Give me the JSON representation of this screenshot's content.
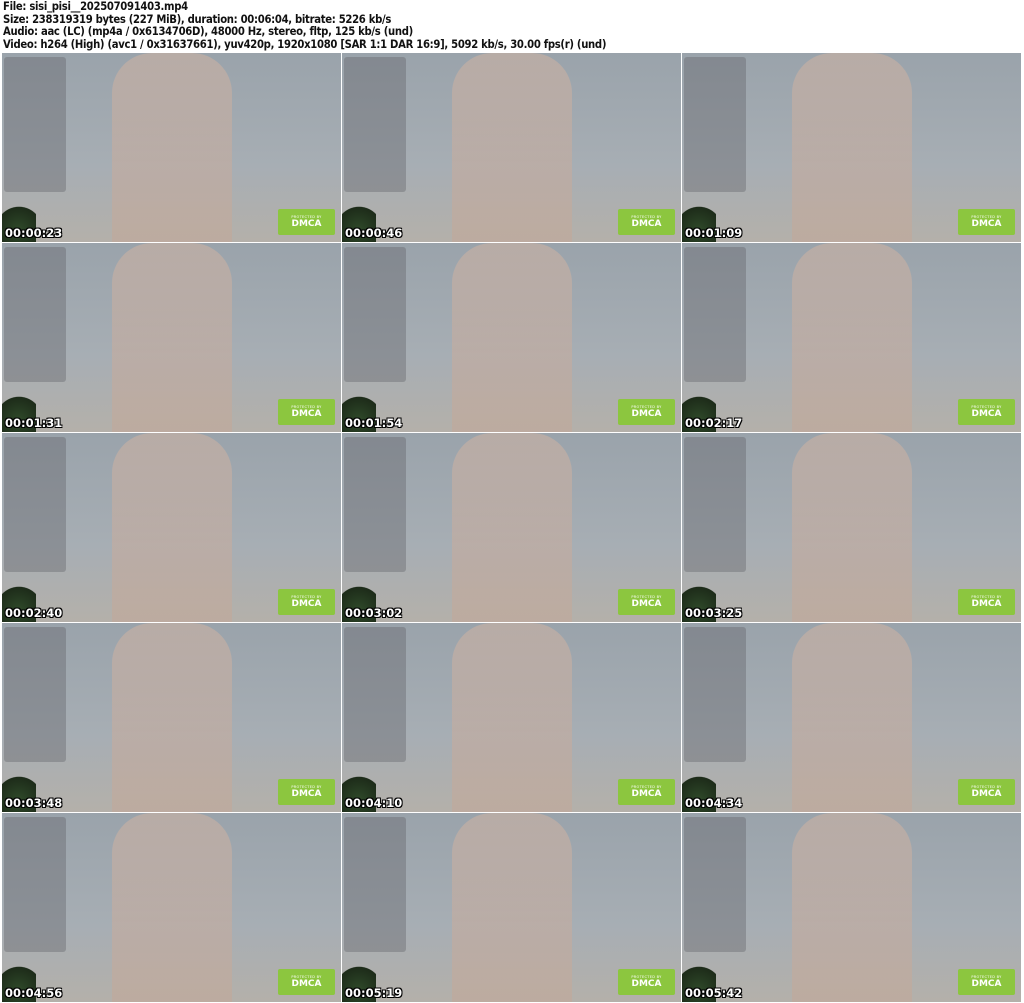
{
  "header": {
    "file": "File: sisi_pisi__202507091403.mp4",
    "size": "Size: 238319319 bytes (227 MiB), duration: 00:06:04, bitrate: 5226 kb/s",
    "audio": "Audio: aac (LC) (mp4a / 0x6134706D), 48000 Hz, stereo, fltp, 125 kb/s (und)",
    "video": "Video: h264 (High) (avc1 / 0x31637661), yuv420p, 1920x1080 [SAR 1:1 DAR 16:9], 5092 kb/s, 30.00 fps(r) (und)"
  },
  "badge": {
    "small": "PROTECTED BY",
    "big": "DMCA",
    "color": "#8cc63f"
  },
  "thumbnails": [
    {
      "timestamp": "00:00:23"
    },
    {
      "timestamp": "00:00:46"
    },
    {
      "timestamp": "00:01:09"
    },
    {
      "timestamp": "00:01:31"
    },
    {
      "timestamp": "00:01:54"
    },
    {
      "timestamp": "00:02:17"
    },
    {
      "timestamp": "00:02:40"
    },
    {
      "timestamp": "00:03:02"
    },
    {
      "timestamp": "00:03:25"
    },
    {
      "timestamp": "00:03:48"
    },
    {
      "timestamp": "00:04:10"
    },
    {
      "timestamp": "00:04:34"
    },
    {
      "timestamp": "00:04:56"
    },
    {
      "timestamp": "00:05:19"
    },
    {
      "timestamp": "00:05:42"
    }
  ]
}
